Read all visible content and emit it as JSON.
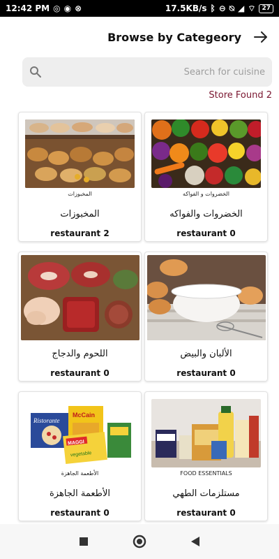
{
  "status_bar": {
    "time": "12:42 PM",
    "left_icons": [
      "whatsapp-icon",
      "messenger-icon",
      "vpn-icon"
    ],
    "network_speed": "17.5KB/s",
    "battery_level": "27"
  },
  "header": {
    "title": "Browse by Categeory"
  },
  "search": {
    "placeholder": "Search for cuisine"
  },
  "results": {
    "store_found": "Store Found 2"
  },
  "categories": [
    {
      "caption": "المخبوزات",
      "name": "المخبوزات",
      "count": "restaurant 2",
      "image": "bakery"
    },
    {
      "caption": "الخضروات و الفواكه",
      "name": "الخضروات والفواكه",
      "count": "restaurant 0",
      "image": "vegetables"
    },
    {
      "caption": "",
      "name": "اللحوم والدجاج",
      "count": "restaurant 0",
      "image": "meat"
    },
    {
      "caption": "",
      "name": "الألبان والبيض",
      "count": "restaurant 0",
      "image": "dairy"
    },
    {
      "caption": "الأطعمة الجاهزة",
      "name": "الأطعمة الجاهزة",
      "count": "restaurant 0",
      "image": "ready-food"
    },
    {
      "caption": "FOOD ESSENTIALS",
      "name": "مستلزمات الطهي",
      "count": "restaurant 0",
      "image": "cooking"
    }
  ],
  "image_text": {
    "ristorante": "Ristorante",
    "mccain": "McCain",
    "maggi": "MAGGI",
    "vegetable": "vegetable"
  },
  "colors": {
    "accent": "#7a1630",
    "search_bg": "#eeeeee",
    "status_bar_bg": "#000000"
  }
}
